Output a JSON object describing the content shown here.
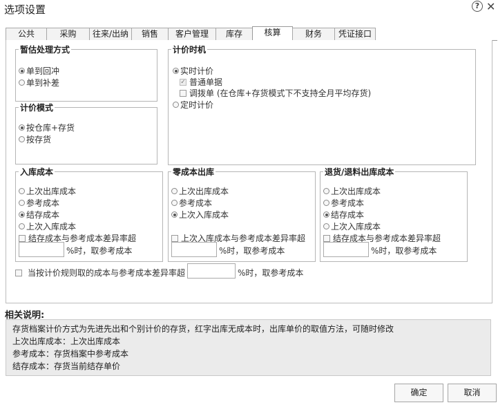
{
  "window": {
    "title": "选项设置",
    "help_glyph": "?",
    "close_glyph": "✕"
  },
  "tabs": [
    "公共",
    "采购",
    "往来/出纳",
    "销售",
    "客户管理",
    "库存",
    "核算",
    "财务",
    "凭证接口"
  ],
  "active_tab": "核算",
  "estimate": {
    "legend": "暂估处理方式",
    "options": [
      "单到回冲",
      "单到补差"
    ],
    "selected": "单到回冲"
  },
  "pricing_time": {
    "legend": "计价时机",
    "realtime_label": "实时计价",
    "normal_doc_label": "普通单据",
    "transfer_doc_label": "调拨单 (在仓库+存货模式下不支持全月平均存货)",
    "scheduled_label": "定时计价",
    "selected": "实时计价"
  },
  "pricing_mode": {
    "legend": "计价模式",
    "options": [
      "按仓库+存货",
      "按存货"
    ],
    "selected": "按仓库+存货"
  },
  "inbound_cost": {
    "legend": "入库成本",
    "options": [
      "上次出库成本",
      "参考成本",
      "结存成本",
      "上次入库成本"
    ],
    "selected": "结存成本",
    "check_label": "结存成本与参考成本差异率超",
    "value": "",
    "suffix": "%时，取参考成本"
  },
  "zero_cost_outbound": {
    "legend": "零成本出库",
    "options": [
      "上次出库成本",
      "参考成本",
      "上次入库成本"
    ],
    "selected": "上次入库成本",
    "check_label": "上次入库成本与参考成本差异率超",
    "value": "",
    "suffix": "%时，取参考成本"
  },
  "return_outbound_cost": {
    "legend": "退货/退料出库成本",
    "options": [
      "上次出库成本",
      "参考成本",
      "结存成本",
      "上次入库成本"
    ],
    "selected": "结存成本",
    "check_label": "结存成本与参考成本差异率超",
    "value": "",
    "suffix": "%时，取参考成本"
  },
  "global_rule": {
    "label": "当按计价规则取的成本与参考成本差异率超",
    "value": "",
    "suffix": "%时，取参考成本"
  },
  "description": {
    "title": "相关说明:",
    "lines": [
      "存货档案计价方式为先进先出和个别计价的存货，红字出库无成本时，出库单价的取值方法，可随时修改",
      "上次出库成本：上次出库成本",
      "参考成本：存货档案中参考成本",
      "结存成本：存货当前结存单价"
    ]
  },
  "buttons": {
    "ok": "确定",
    "cancel": "取消"
  }
}
